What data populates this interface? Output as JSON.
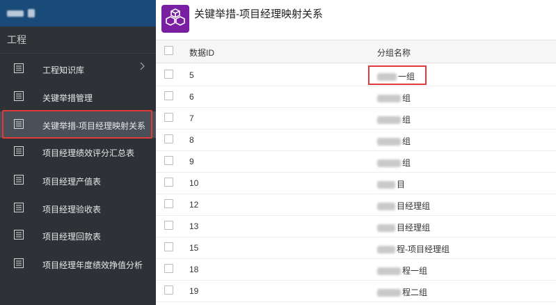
{
  "sidebar": {
    "group_label": "工程",
    "items": [
      {
        "label": "工程知识库",
        "has_chevron": true
      },
      {
        "label": "关键举措管理"
      },
      {
        "label": "关键举措-项目经理映射关系",
        "active": true
      },
      {
        "label": "项目经理绩效评分汇总表"
      },
      {
        "label": "项目经理产值表"
      },
      {
        "label": "项目经理验收表"
      },
      {
        "label": "项目经理回款表"
      },
      {
        "label": "项目经理年度绩效挣值分析"
      }
    ]
  },
  "header": {
    "title": "关键举措-项目经理映射关系",
    "icon": "cubes-icon"
  },
  "table": {
    "columns": [
      "数据ID",
      "分组名称"
    ],
    "rows": [
      {
        "id": "5",
        "name": "一组"
      },
      {
        "id": "6",
        "name": "组"
      },
      {
        "id": "7",
        "name": "组"
      },
      {
        "id": "8",
        "name": "组"
      },
      {
        "id": "9",
        "name": "组"
      },
      {
        "id": "10",
        "name": "目"
      },
      {
        "id": "12",
        "name": "目经理组"
      },
      {
        "id": "13",
        "name": "目经理组"
      },
      {
        "id": "15",
        "name": "程-项目经理组"
      },
      {
        "id": "18",
        "name": "程一组"
      },
      {
        "id": "19",
        "name": "程二组"
      }
    ]
  },
  "colors": {
    "sidebar_bg": "#2e3236",
    "topbar_bg": "#1a4a78",
    "active_bg": "#495058",
    "highlight": "#e03a3a",
    "app_icon_bg": "#7b1fa2"
  }
}
